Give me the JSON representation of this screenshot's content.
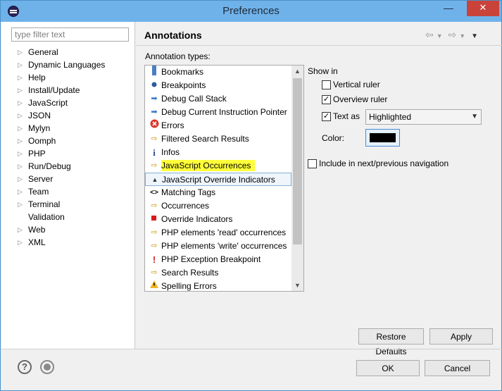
{
  "window": {
    "title": "Preferences",
    "minimize_glyph": "—",
    "close_glyph": "✕"
  },
  "filter": {
    "placeholder": "type filter text",
    "value": ""
  },
  "tree": [
    {
      "label": "General",
      "expandable": true
    },
    {
      "label": "Dynamic Languages",
      "expandable": true
    },
    {
      "label": "Help",
      "expandable": true
    },
    {
      "label": "Install/Update",
      "expandable": true
    },
    {
      "label": "JavaScript",
      "expandable": true
    },
    {
      "label": "JSON",
      "expandable": true
    },
    {
      "label": "Mylyn",
      "expandable": true
    },
    {
      "label": "Oomph",
      "expandable": true
    },
    {
      "label": "PHP",
      "expandable": true
    },
    {
      "label": "Run/Debug",
      "expandable": true
    },
    {
      "label": "Server",
      "expandable": true
    },
    {
      "label": "Team",
      "expandable": true
    },
    {
      "label": "Terminal",
      "expandable": true
    },
    {
      "label": "Validation",
      "expandable": false
    },
    {
      "label": "Web",
      "expandable": true
    },
    {
      "label": "XML",
      "expandable": true
    }
  ],
  "page": {
    "title": "Annotations",
    "annotation_types_label": "Annotation types:",
    "annotation_types": [
      {
        "label": "Bookmarks",
        "icon": "bookmark-icon",
        "state": ""
      },
      {
        "label": "Breakpoints",
        "icon": "breakpoint-icon",
        "state": ""
      },
      {
        "label": "Debug Call Stack",
        "icon": "debug-arrow-icon",
        "state": ""
      },
      {
        "label": "Debug Current Instruction Pointer",
        "icon": "debug-arrow-icon",
        "state": ""
      },
      {
        "label": "Errors",
        "icon": "error-icon",
        "state": ""
      },
      {
        "label": "Filtered Search Results",
        "icon": "search-result-icon",
        "state": ""
      },
      {
        "label": "Infos",
        "icon": "info-icon",
        "state": ""
      },
      {
        "label": "JavaScript Occurrences",
        "icon": "occurrence-icon",
        "state": "highlighted"
      },
      {
        "label": "JavaScript Override Indicators",
        "icon": "override-indicator-icon",
        "state": "selected"
      },
      {
        "label": "Matching Tags",
        "icon": "matching-tags-icon",
        "state": ""
      },
      {
        "label": "Occurrences",
        "icon": "occurrence-icon",
        "state": ""
      },
      {
        "label": "Override Indicators",
        "icon": "override-square-icon",
        "state": ""
      },
      {
        "label": "PHP elements 'read' occurrences",
        "icon": "occurrence-icon",
        "state": ""
      },
      {
        "label": "PHP elements 'write' occurrences",
        "icon": "occurrence-icon",
        "state": ""
      },
      {
        "label": "PHP Exception Breakpoint",
        "icon": "exclamation-icon",
        "state": ""
      },
      {
        "label": "Search Results",
        "icon": "search-result-icon",
        "state": ""
      },
      {
        "label": "Spelling Errors",
        "icon": "warning-icon",
        "state": ""
      }
    ],
    "show_in": {
      "label": "Show in",
      "vertical_ruler": {
        "label": "Vertical ruler",
        "checked": false
      },
      "overview_ruler": {
        "label": "Overview ruler",
        "checked": true
      },
      "text_as": {
        "label": "Text as",
        "checked": true,
        "selected": "Highlighted"
      }
    },
    "color": {
      "label": "Color:",
      "value": "#000000"
    },
    "include_nav": {
      "label": "Include in next/previous navigation",
      "checked": false
    },
    "restore_defaults_label": "Restore Defaults",
    "apply_label": "Apply"
  },
  "footer": {
    "ok_label": "OK",
    "cancel_label": "Cancel",
    "help_glyph": "?"
  },
  "colors": {
    "titlebar": "#6fb2ea",
    "close": "#c9433b",
    "highlight": "#ffff3a",
    "selection_border": "#84b0d6"
  }
}
